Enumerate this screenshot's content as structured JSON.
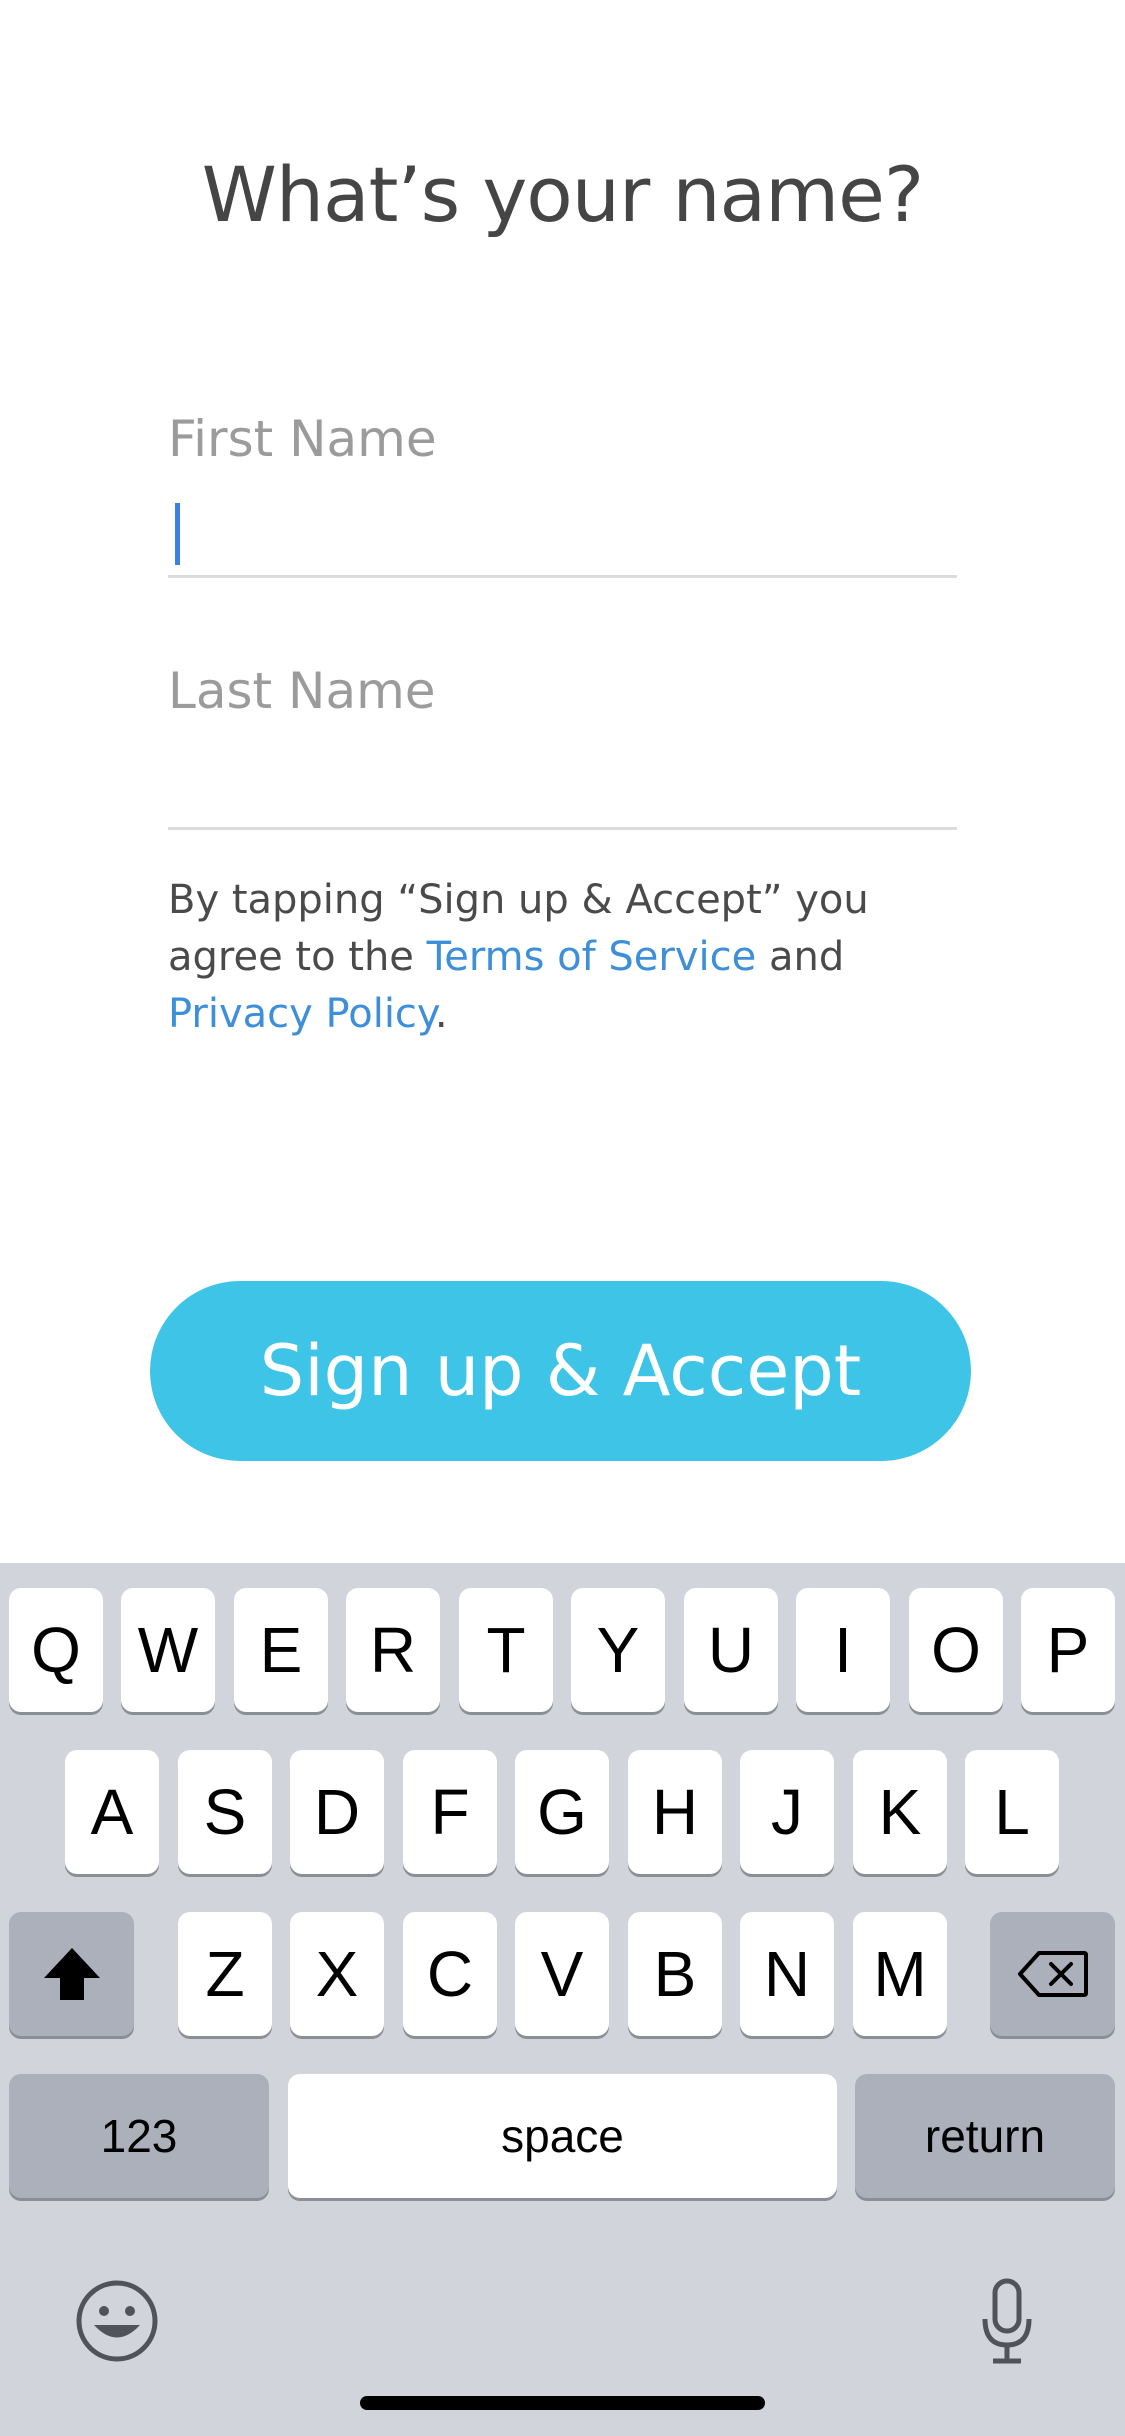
{
  "screen": {
    "title": "What’s your name?",
    "first_name": {
      "label": "First Name",
      "value": ""
    },
    "last_name": {
      "label": "Last Name",
      "value": ""
    },
    "terms": {
      "prefix": "By tapping “Sign up & Accept” you agree to the ",
      "terms_link": "Terms of Service",
      "middle": " and ",
      "privacy_link": "Privacy Policy",
      "suffix": "."
    },
    "signup_button": "Sign up & Accept"
  },
  "keyboard": {
    "row1": [
      "Q",
      "W",
      "E",
      "R",
      "T",
      "Y",
      "U",
      "I",
      "O",
      "P"
    ],
    "row2": [
      "A",
      "S",
      "D",
      "F",
      "G",
      "H",
      "J",
      "K",
      "L"
    ],
    "row3": [
      "Z",
      "X",
      "C",
      "V",
      "B",
      "N",
      "M"
    ],
    "numbers_key": "123",
    "space_key": "space",
    "return_key": "return",
    "icons": {
      "shift": "shift-icon",
      "delete": "backspace-icon",
      "emoji": "emoji-icon",
      "mic": "microphone-icon"
    }
  },
  "colors": {
    "accent": "#3ec4e6",
    "link": "#3d8fd9",
    "caret": "#3b82e0"
  }
}
